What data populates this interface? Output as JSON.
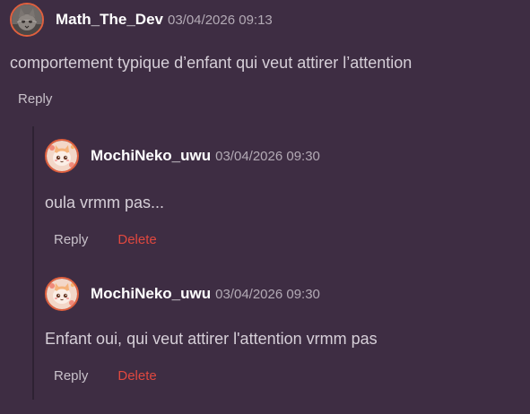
{
  "comments": [
    {
      "author": "Math_The_Dev",
      "timestamp": "03/04/2026 09:13",
      "text": "comportement typique d’enfant qui veut attirer l’attention",
      "reply_label": "Reply",
      "avatar": "cat-avatar-icon"
    }
  ],
  "replies": [
    {
      "author": "MochiNeko_uwu",
      "timestamp": "03/04/2026 09:30",
      "text": "oula vrmm pas...",
      "reply_label": "Reply",
      "delete_label": "Delete",
      "avatar": "anime-cat-avatar-icon"
    },
    {
      "author": "MochiNeko_uwu",
      "timestamp": "03/04/2026 09:30",
      "text": "Enfant oui, qui veut attirer l'attention vrmm pas",
      "reply_label": "Reply",
      "delete_label": "Delete",
      "avatar": "anime-cat-avatar-icon"
    }
  ],
  "colors": {
    "background": "#3e2d43",
    "author": "#ffffff",
    "timestamp": "#b3aab5",
    "text": "#d6cfd8",
    "reply": "#c8c1ca",
    "delete": "#e0483f",
    "avatar_border": "#e0603e"
  }
}
